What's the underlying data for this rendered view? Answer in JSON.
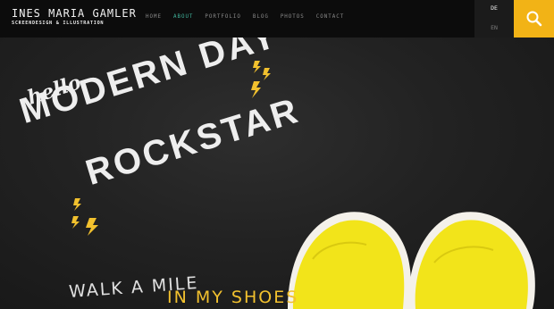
{
  "brand": {
    "name": "INES MARIA GAMLER",
    "tagline": "SCREENDESIGN & ILLUSTRATION"
  },
  "nav": {
    "items": [
      {
        "label": "HOME",
        "active": false
      },
      {
        "label": "ABOUT",
        "active": true
      },
      {
        "label": "PORTFOLIO",
        "active": false
      },
      {
        "label": "BLOG",
        "active": false
      },
      {
        "label": "PHOTOS",
        "active": false
      },
      {
        "label": "CONTACT",
        "active": false
      }
    ],
    "active_color": "#3fb29a"
  },
  "language": {
    "selected": "DE",
    "other": "EN"
  },
  "search": {
    "icon": "search-icon",
    "color": "#f2b316"
  },
  "hero": {
    "hello": "hello",
    "line1": "MODERN DAY",
    "line2": "ROCKSTAR",
    "walk": "WALK A MILE",
    "shoes": "IN MY SHOES",
    "accent": "#f2c12e",
    "shoe_color": "#f2e41a"
  }
}
